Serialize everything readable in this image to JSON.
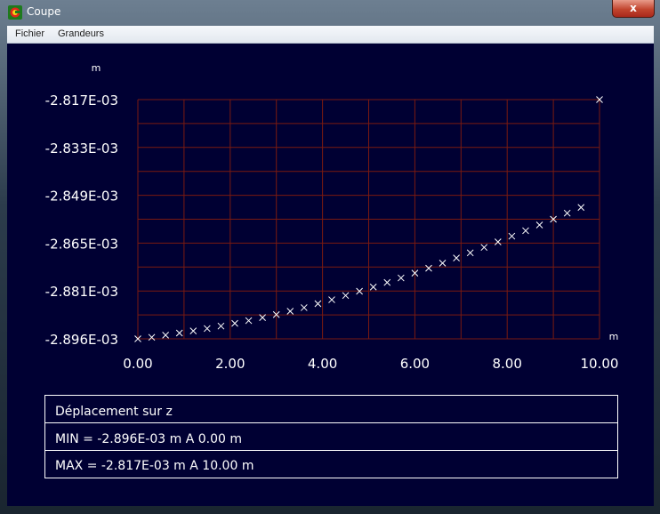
{
  "window": {
    "title": "Coupe",
    "close_label": "x"
  },
  "menu": {
    "items": [
      "Fichier",
      "Grandeurs"
    ]
  },
  "chart_data": {
    "type": "scatter",
    "ylabel": "m",
    "xlabel": "m",
    "xlim": [
      0,
      10
    ],
    "ylim": [
      -0.002896,
      -0.002817
    ],
    "x_ticks": [
      "0.00",
      "2.00",
      "4.00",
      "6.00",
      "8.00",
      "10.00"
    ],
    "y_ticks": [
      "-2.817E-03",
      "-2.833E-03",
      "-2.849E-03",
      "-2.865E-03",
      "-2.881E-03",
      "-2.896E-03"
    ],
    "grid": true,
    "marker": "x",
    "colors": {
      "background": "#000033",
      "grid": "#7a1a10",
      "marker": "#ffffff",
      "text": "#ffffff"
    },
    "x": [
      0.0,
      0.3,
      0.6,
      0.9,
      1.2,
      1.5,
      1.8,
      2.1,
      2.4,
      2.7,
      3.0,
      3.3,
      3.6,
      3.9,
      4.2,
      4.5,
      4.8,
      5.1,
      5.4,
      5.7,
      6.0,
      6.3,
      6.6,
      6.9,
      7.2,
      7.5,
      7.8,
      8.1,
      8.4,
      8.7,
      9.0,
      9.3,
      9.6,
      10.0
    ],
    "y": [
      -0.002896,
      -0.0028955,
      -0.0028948,
      -0.0028941,
      -0.0028934,
      -0.0028926,
      -0.0028918,
      -0.0028909,
      -0.00289,
      -0.002889,
      -0.002888,
      -0.0028869,
      -0.0028857,
      -0.0028844,
      -0.0028831,
      -0.0028817,
      -0.0028803,
      -0.0028789,
      -0.0028774,
      -0.0028759,
      -0.0028743,
      -0.0028727,
      -0.002871,
      -0.0028693,
      -0.0028676,
      -0.0028658,
      -0.002864,
      -0.0028621,
      -0.0028603,
      -0.0028584,
      -0.0028565,
      -0.0028545,
      -0.0028526,
      -0.002817
    ]
  },
  "info": {
    "title": "Déplacement sur z",
    "min_row": "MIN = -2.896E-03 m  A 0.00 m",
    "max_row": "MAX = -2.817E-03 m  A 10.00 m"
  }
}
